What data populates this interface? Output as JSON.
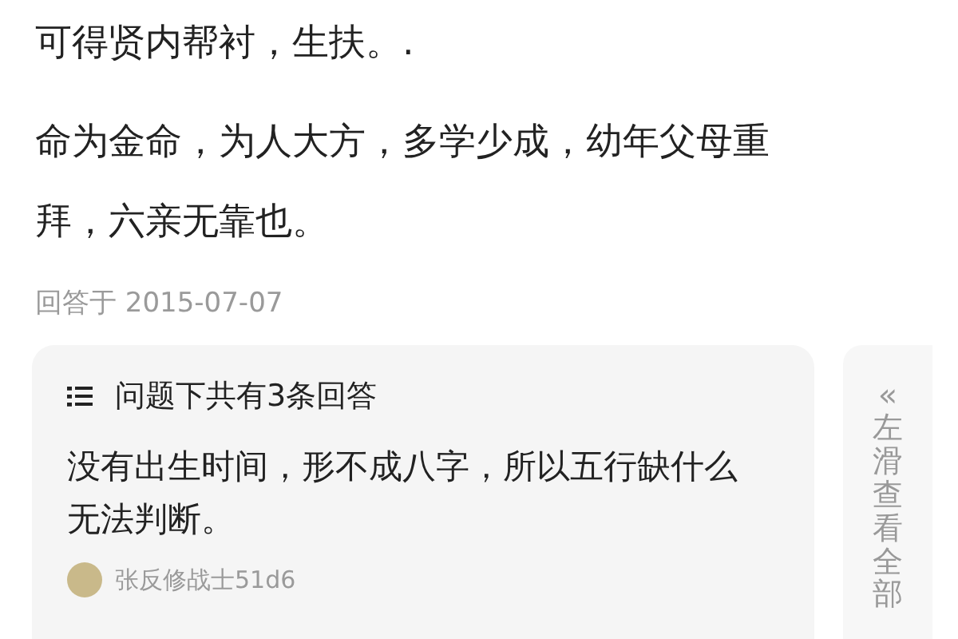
{
  "answer": {
    "paragraphs": [
      "可得贤内帮衬，生扶。.",
      "命为金命，为人大方，多学少成，幼年父母重拜，六亲无靠也。"
    ],
    "date": "回答于 2015-07-07"
  },
  "other_answers": {
    "title": "问题下共有3条回答",
    "text": "没有出生时间，形不成八字，所以五行缺什么无法判断。",
    "author": "张反修战士51d6"
  },
  "side_hint": {
    "arrow": "«",
    "text": "左滑查看全部"
  }
}
